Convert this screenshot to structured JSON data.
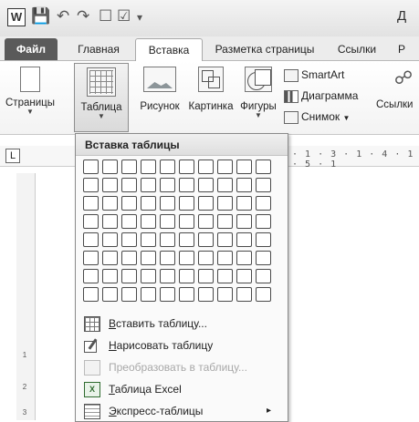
{
  "qat": {
    "app_icon_letter": "W",
    "doc_title_fragment": "Д"
  },
  "tabs": [
    {
      "label": "Файл"
    },
    {
      "label": "Главная"
    },
    {
      "label": "Вставка"
    },
    {
      "label": "Разметка страницы"
    },
    {
      "label": "Ссылки"
    },
    {
      "label": "Р"
    }
  ],
  "ribbon": {
    "pages_label": "Страницы",
    "table_label": "Таблица",
    "picture_label": "Рисунок",
    "clipart_label": "Картинка",
    "shapes_label": "Фигуры",
    "smartart_label": "SmartArt",
    "chart_label": "Диаграмма",
    "screenshot_label": "Снимок",
    "links_label": "Ссылки"
  },
  "ruler": {
    "marks": "· 1 · 3 · 1 · 4 · 1 · 5 · 1",
    "tab_stop": "L"
  },
  "vruler_ticks": [
    "1",
    "2",
    "3"
  ],
  "dropdown": {
    "header": "Вставка таблицы",
    "grid": {
      "cols": 10,
      "rows": 8
    },
    "items": [
      {
        "label": "Вставить таблицу...",
        "icon": "insert-table-icon",
        "enabled": true,
        "submenu": false
      },
      {
        "label": "Нарисовать таблицу",
        "icon": "pencil-icon",
        "enabled": true,
        "submenu": false
      },
      {
        "label": "Преобразовать в таблицу...",
        "icon": "convert-icon",
        "enabled": false,
        "submenu": false
      },
      {
        "label": "Таблица Excel",
        "icon": "excel-icon",
        "enabled": true,
        "submenu": false
      },
      {
        "label": "Экспресс-таблицы",
        "icon": "quick-tables-icon",
        "enabled": true,
        "submenu": true
      }
    ]
  }
}
